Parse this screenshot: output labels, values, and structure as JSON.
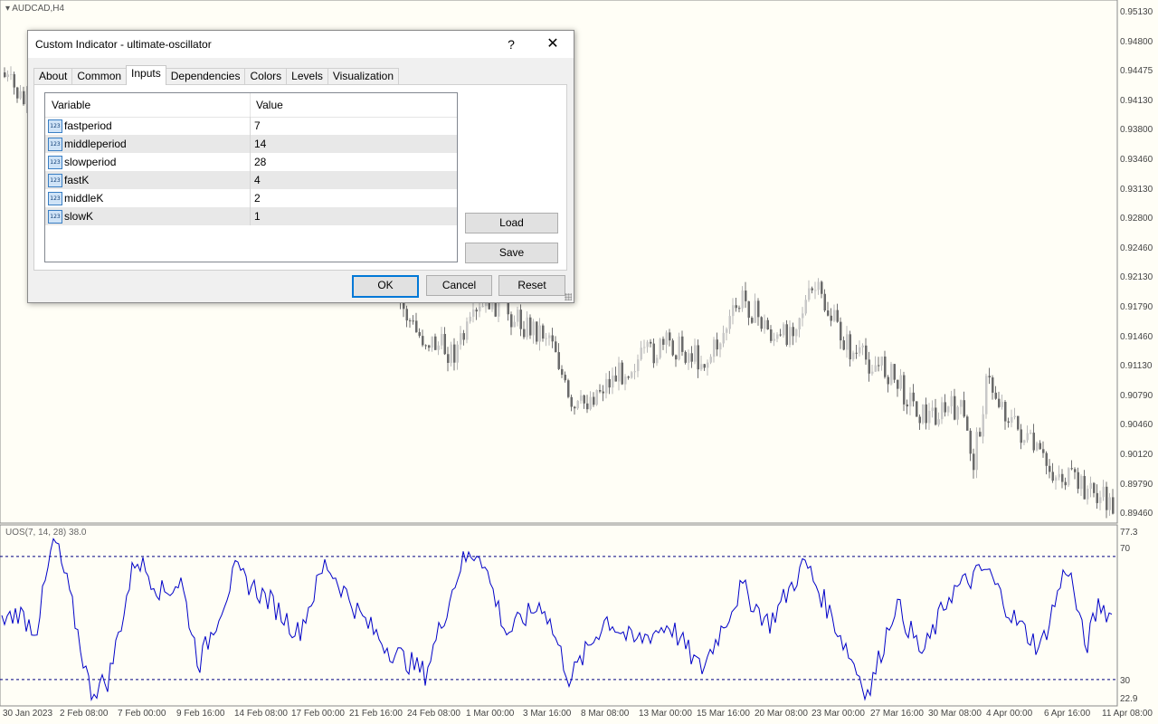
{
  "chart": {
    "symbol": "AUDCAD,H4",
    "price_axis": [
      "0.95130",
      "0.94800",
      "0.94475",
      "0.94130",
      "0.93800",
      "0.93460",
      "0.93130",
      "0.92800",
      "0.92460",
      "0.92130",
      "0.91790",
      "0.91460",
      "0.91130",
      "0.90790",
      "0.90460",
      "0.90120",
      "0.89790",
      "0.89460"
    ],
    "date_axis": [
      "30 Jan 2023",
      "2 Feb 08:00",
      "7 Feb 00:00",
      "9 Feb 16:00",
      "14 Feb 08:00",
      "17 Feb 00:00",
      "21 Feb 16:00",
      "24 Feb 08:00",
      "1 Mar 00:00",
      "3 Mar 16:00",
      "8 Mar 08:00",
      "13 Mar 00:00",
      "15 Mar 16:00",
      "20 Mar 08:00",
      "23 Mar 00:00",
      "27 Mar 16:00",
      "30 Mar 08:00",
      "4 Apr 00:00",
      "6 Apr 16:00",
      "11 Apr 08:00"
    ],
    "indicator": {
      "label": "UOS(7, 14, 28) 38.0",
      "axis": [
        "77.3",
        "70",
        "30",
        "22.9"
      ],
      "levels": [
        70,
        30
      ],
      "range": [
        22.9,
        77.3
      ],
      "line_color": "#0000c8"
    }
  },
  "dialog": {
    "title": "Custom Indicator - ultimate-oscillator",
    "help": "?",
    "close": "✕",
    "tabs": [
      "About",
      "Common",
      "Inputs",
      "Dependencies",
      "Colors",
      "Levels",
      "Visualization"
    ],
    "active_tab": "Inputs",
    "grid": {
      "headers": [
        "Variable",
        "Value"
      ],
      "icon_text": "123",
      "rows": [
        {
          "name": "fastperiod",
          "value": "7"
        },
        {
          "name": "middleperiod",
          "value": "14"
        },
        {
          "name": "slowperiod",
          "value": "28"
        },
        {
          "name": "fastK",
          "value": "4"
        },
        {
          "name": "middleK",
          "value": "2"
        },
        {
          "name": "slowK",
          "value": "1"
        }
      ]
    },
    "buttons": {
      "load": "Load",
      "save": "Save",
      "ok": "OK",
      "cancel": "Cancel",
      "reset": "Reset"
    }
  }
}
